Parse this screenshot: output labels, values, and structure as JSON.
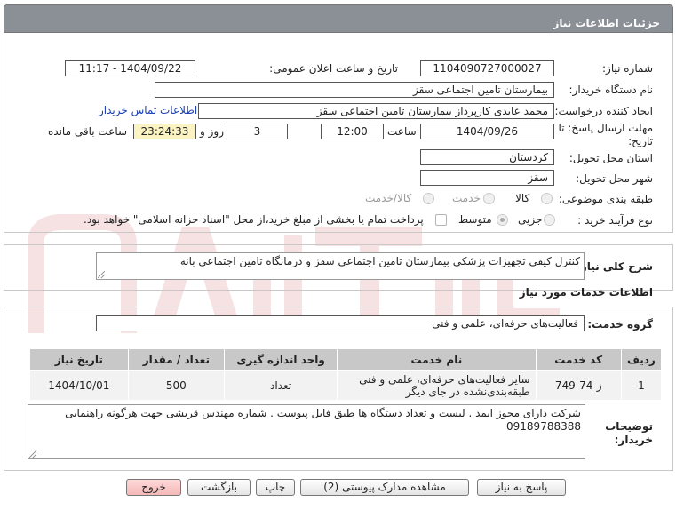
{
  "header": {
    "title": "جزئیات اطلاعات نیاز"
  },
  "form": {
    "need_number_label": "شماره نیاز:",
    "need_number": "1104090727000027",
    "announce_label": "تاریخ و ساعت اعلان عمومی:",
    "announce_value": "1404/09/22 - 11:17",
    "buyer_org_label": "نام دستگاه خریدار:",
    "buyer_org": "بیمارستان تامین اجتماعی سقز",
    "requester_label": "ایجاد کننده درخواست:",
    "requester": "محمد عابدی کارپرداز بیمارستان تامین اجتماعی سقز",
    "contact_link": "اطلاعات تماس خریدار",
    "deadline_label_1": "مهلت ارسال پاسخ: تا",
    "deadline_label_2": "تاریخ:",
    "deadline_date": "1404/09/26",
    "time_label": "ساعت",
    "deadline_time": "12:00",
    "days_value": "3",
    "days_label": "روز و",
    "remaining_time": "23:24:33",
    "remaining_label": "ساعت باقی مانده",
    "province_label": "استان محل تحویل:",
    "province": "کردستان",
    "city_label": "شهر محل تحویل:",
    "city": "سقز",
    "category_label": "طبقه بندی موضوعی:",
    "category_options": [
      "کالا",
      "خدمت",
      "کالا/خدمت"
    ],
    "process_label": "نوع فرآیند خرید :",
    "process_options": [
      "جزیی",
      "متوسط"
    ],
    "payment_note": "پرداخت تمام یا بخشی از مبلغ خرید،از محل \"اسناد خزانه اسلامی\" خواهد بود."
  },
  "summary": {
    "label": "شرح کلی نیاز:",
    "text": "کنترل کیفی تجهیزات پزشکی بیمارستان تامین اجتماعی سقز و درمانگاه تامین اجتماعی بانه"
  },
  "services": {
    "title": "اطلاعات خدمات مورد نیاز",
    "group_label": "گروه خدمت:",
    "group_value": "فعالیت‌های حرفه‌ای، علمی و فنی",
    "table": {
      "headers": [
        "ردیف",
        "کد خدمت",
        "نام خدمت",
        "واحد اندازه گیری",
        "تعداد / مقدار",
        "تاریخ نیاز"
      ],
      "rows": [
        [
          "1",
          "ز-74-749",
          "سایر فعالیت‌های حرفه‌ای، علمی و فنی طبقه‌بندی‌نشده در جای دیگر",
          "تعداد",
          "500",
          "1404/10/01"
        ]
      ]
    }
  },
  "buyer_notes": {
    "label_1": "توضیحات",
    "label_2": "خریدار:",
    "text": "شرکت دارای مجوز ایمد . لیست و تعداد دستگاه ها طبق فایل پیوست . شماره مهندس قریشی جهت هرگونه راهنمایی 09189788388"
  },
  "buttons": {
    "reply": "پاسخ به نیاز",
    "attachments": "مشاهده مدارک پیوستی (2)",
    "print": "چاپ",
    "back": "بازگشت",
    "exit": "خروج"
  },
  "colors": {
    "header_bg": "#8b8f96",
    "table_header_bg": "#c8c8c8",
    "exit_button": "#f5b8b8",
    "link": "#1b3fb8"
  }
}
